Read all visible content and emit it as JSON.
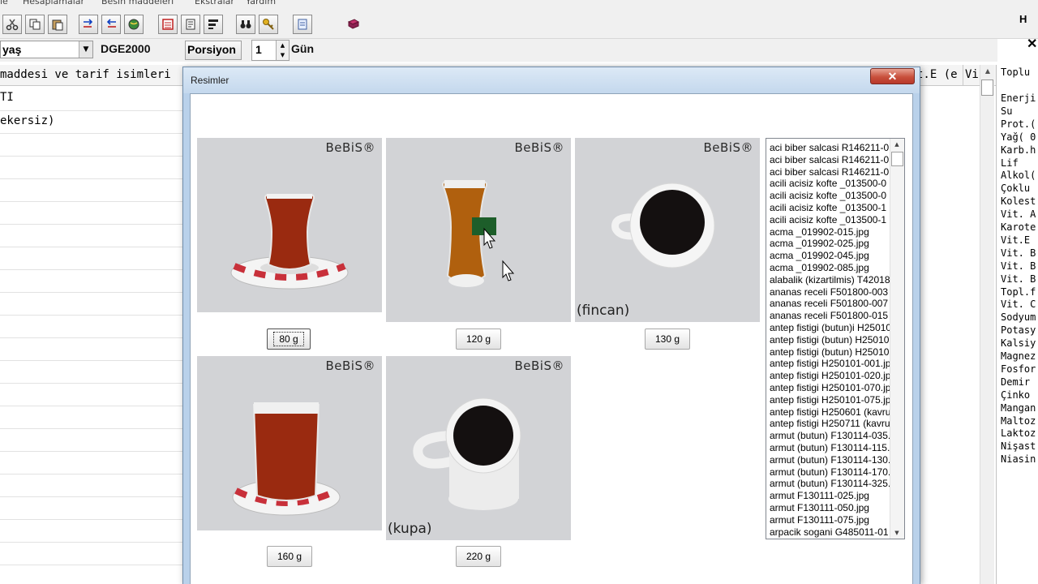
{
  "menubar": [
    "le",
    "Hesaplamalar",
    "Besin maddeleri",
    "Ekstralar",
    "Yardım"
  ],
  "toolbar": {
    "icons": [
      "scissors-icon",
      "copy-icon",
      "paste-icon",
      "move-right-icon",
      "move-left-icon",
      "earth-icon",
      "calculator-icon",
      "report-icon",
      "chart-icon",
      "binoculars-icon",
      "key-icon",
      "notes-icon",
      "book-icon"
    ]
  },
  "controls": {
    "combo_value": "yaş",
    "standard": "DGE2000",
    "porsiyon_label": "Porsiyon",
    "spin_value": "1",
    "unit": "Gün"
  },
  "grid": {
    "header_first": "maddesi ve tarif isimleri",
    "header_mid": "t.E (e",
    "header_last": "Vi",
    "rows": [
      "TI",
      "ekersiz)"
    ]
  },
  "right_panel": {
    "header_right": "H",
    "close": "✕",
    "title": "Toplu",
    "items": [
      "Enerji",
      "Su",
      "Prot.(",
      "Yağ( 0",
      "Karb.h",
      "Lif",
      "Alkol(",
      "Çoklu",
      "Kolest",
      "Vit. A",
      "Karote",
      "Vit.E",
      "Vit. B",
      "Vit. B",
      "Vit. B",
      "Topl.f",
      "Vit. C",
      "Sodyum",
      "Potasy",
      "Kalsiy",
      "Magnez",
      "Fosfor",
      "Demir",
      "Çinko",
      "Mangan",
      "Maltoz",
      "Laktoz",
      "Nişast",
      "Niasin"
    ]
  },
  "dialog": {
    "title": "Resimler",
    "close": "✕",
    "photos": [
      {
        "brand": "BeBiS®",
        "caption": "",
        "button": "80 g"
      },
      {
        "brand": "BeBiS®",
        "caption": "",
        "button": "120 g"
      },
      {
        "brand": "BeBiS®",
        "caption": "(fincan)",
        "button": "130 g"
      },
      {
        "brand": "BeBiS®",
        "caption": "",
        "button": "160 g"
      },
      {
        "brand": "BeBiS®",
        "caption": "(kupa)",
        "button": "220 g"
      }
    ],
    "files": [
      "aci biber salcasi R146211-0",
      "aci biber salcasi R146211-0",
      "aci biber salcasi R146211-0",
      "acili acisiz kofte _013500-0",
      "acili acisiz kofte _013500-0",
      "acili acisiz kofte _013500-1",
      "acili acisiz kofte _013500-1",
      "acma _019902-015.jpg",
      "acma _019902-025.jpg",
      "acma _019902-045.jpg",
      "acma _019902-085.jpg",
      "alabalik (kizartilmis) T42018",
      "ananas receli F501800-003",
      "ananas receli F501800-007",
      "ananas receli F501800-015",
      "antep fistigi (butun)i H25010",
      "antep fistigi (butun) H25010",
      "antep fistigi (butun) H25010",
      "antep fistigi H250101-001.jp",
      "antep fistigi H250101-020.jp",
      "antep fistigi H250101-070.jp",
      "antep fistigi H250101-075.jp",
      "antep fistigi H250601 (kavru",
      "antep fistigi H250711 (kavru",
      "armut (butun) F130114-035.",
      "armut (butun) F130114-115.",
      "armut (butun) F130114-130.",
      "armut (butun) F130114-170.",
      "armut (butun) F130114-325.",
      "armut F130111-025.jpg",
      "armut F130111-050.jpg",
      "armut F130111-075.jpg",
      "arpacik sogani G485011-01"
    ]
  }
}
